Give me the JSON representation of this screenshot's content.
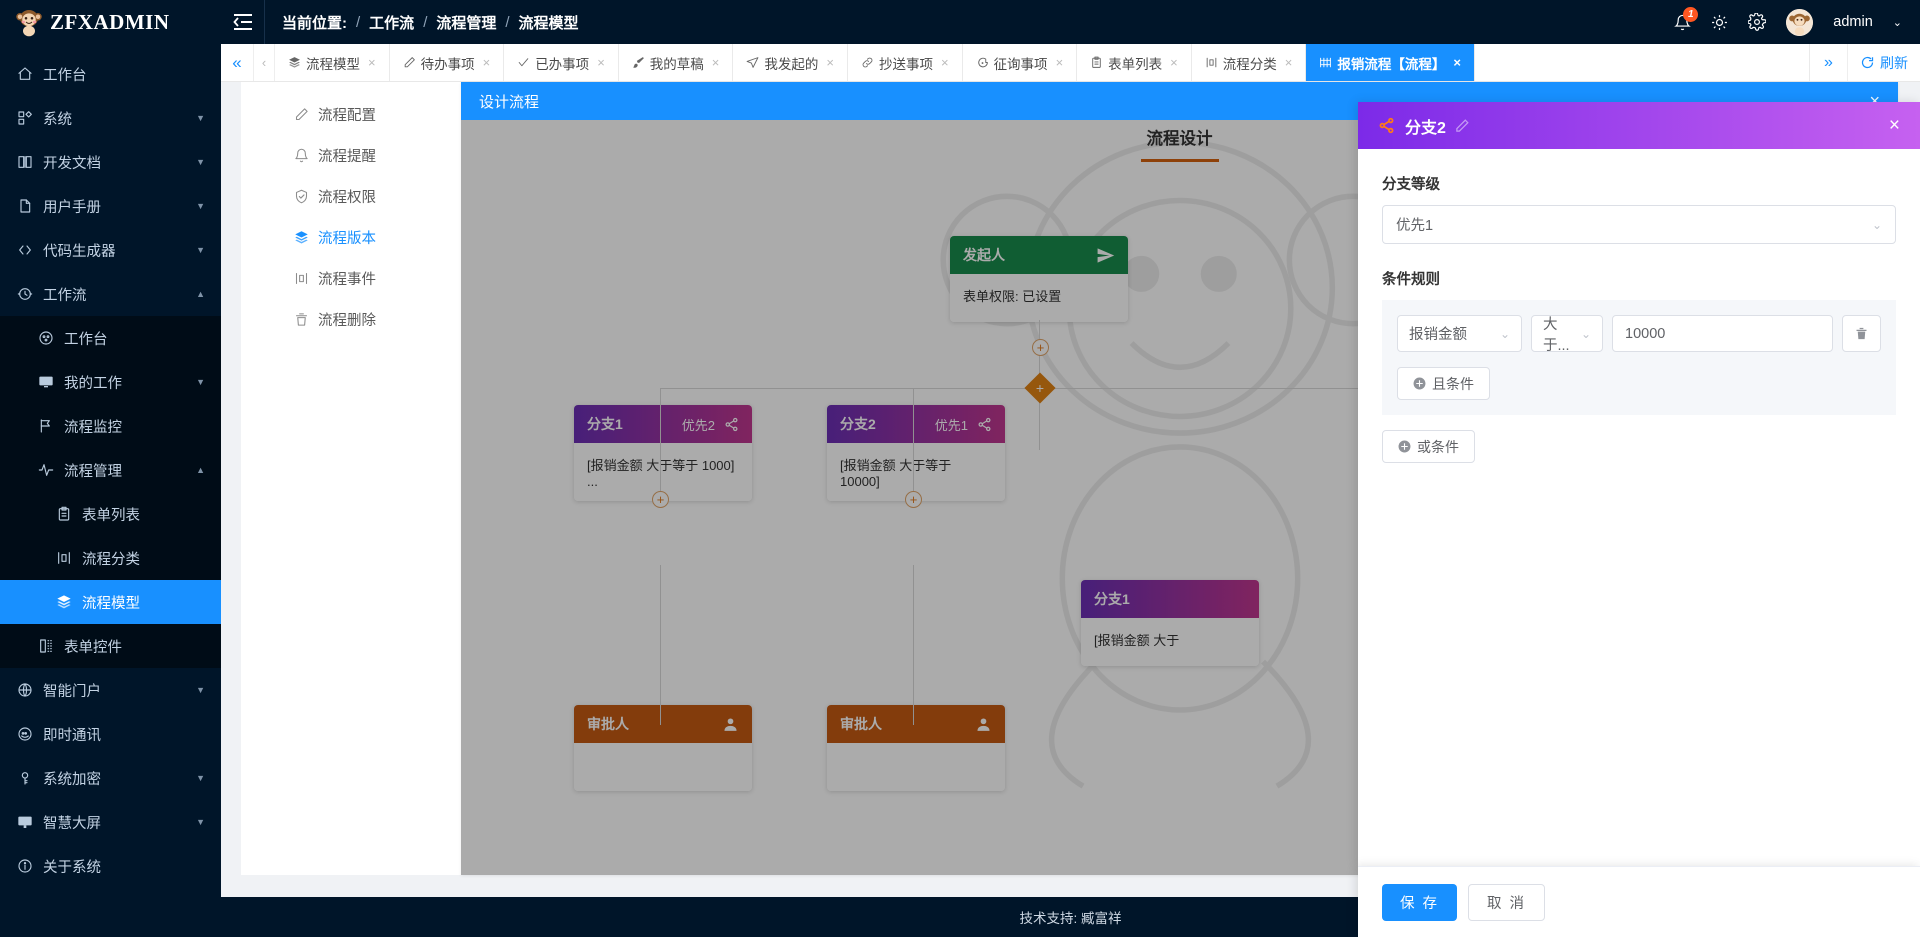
{
  "brand": {
    "name": "ZFXADMIN"
  },
  "header": {
    "breadcrumb_label": "当前位置:",
    "breadcrumb": [
      "工作流",
      "流程管理",
      "流程模型"
    ],
    "separator": "/",
    "notification_count": "1",
    "username": "admin"
  },
  "sidebar": {
    "items": [
      {
        "label": "工作台",
        "icon": "home-icon",
        "level": 0,
        "caret": false,
        "active": false
      },
      {
        "label": "系统",
        "icon": "apps-icon",
        "level": 0,
        "caret": true,
        "active": false
      },
      {
        "label": "开发文档",
        "icon": "book-icon",
        "level": 0,
        "caret": true,
        "active": false
      },
      {
        "label": "用户手册",
        "icon": "doc-icon",
        "level": 0,
        "caret": true,
        "active": false
      },
      {
        "label": "代码生成器",
        "icon": "code-icon",
        "level": 0,
        "caret": true,
        "active": false
      },
      {
        "label": "工作流",
        "icon": "workflow-icon",
        "level": 0,
        "caret": true,
        "active": false,
        "expanded": true
      },
      {
        "label": "工作台",
        "icon": "dashboard-icon",
        "level": 1,
        "caret": false,
        "active": false
      },
      {
        "label": "我的工作",
        "icon": "monitor-icon",
        "level": 1,
        "caret": true,
        "active": false
      },
      {
        "label": "流程监控",
        "icon": "flag-icon",
        "level": 1,
        "caret": false,
        "active": false
      },
      {
        "label": "流程管理",
        "icon": "pulse-icon",
        "level": 1,
        "caret": true,
        "active": false,
        "expanded": true
      },
      {
        "label": "表单列表",
        "icon": "clipboard-icon",
        "level": 2,
        "caret": false,
        "active": false
      },
      {
        "label": "流程分类",
        "icon": "category-icon",
        "level": 2,
        "caret": false,
        "active": false
      },
      {
        "label": "流程模型",
        "icon": "layers-icon",
        "level": 2,
        "caret": false,
        "active": true
      },
      {
        "label": "表单控件",
        "icon": "widget-icon",
        "level": 1,
        "caret": false,
        "active": false
      },
      {
        "label": "智能门户",
        "icon": "globe-icon",
        "level": 0,
        "caret": true,
        "active": false
      },
      {
        "label": "即时通讯",
        "icon": "chat-icon",
        "level": 0,
        "caret": false,
        "active": false
      },
      {
        "label": "系统加密",
        "icon": "key-icon",
        "level": 0,
        "caret": true,
        "active": false
      },
      {
        "label": "智慧大屏",
        "icon": "screen-icon",
        "level": 0,
        "caret": true,
        "active": false
      },
      {
        "label": "关于系统",
        "icon": "info-icon",
        "level": 0,
        "caret": false,
        "active": false
      }
    ]
  },
  "tabs": {
    "items": [
      {
        "label": "流程模型",
        "icon": "layers-icon",
        "active": false
      },
      {
        "label": "待办事项",
        "icon": "pen-icon",
        "active": false
      },
      {
        "label": "已办事项",
        "icon": "check-icon",
        "active": false
      },
      {
        "label": "我的草稿",
        "icon": "brush-icon",
        "active": false
      },
      {
        "label": "我发起的",
        "icon": "send-icon",
        "active": false
      },
      {
        "label": "抄送事项",
        "icon": "link-icon",
        "active": false
      },
      {
        "label": "征询事项",
        "icon": "comment-icon",
        "active": false
      },
      {
        "label": "表单列表",
        "icon": "clipboard-icon",
        "active": false
      },
      {
        "label": "流程分类",
        "icon": "category-icon",
        "active": false
      },
      {
        "label": "报销流程【流程】",
        "icon": "flow-icon",
        "active": true
      }
    ],
    "close_glyph": "×",
    "refresh_label": "刷新"
  },
  "side_menu": {
    "items": [
      {
        "label": "流程配置",
        "icon": "pen-icon",
        "active": false
      },
      {
        "label": "流程提醒",
        "icon": "bell-icon",
        "active": false
      },
      {
        "label": "流程权限",
        "icon": "shield-icon",
        "active": false
      },
      {
        "label": "流程版本",
        "icon": "layers-icon",
        "active": true
      },
      {
        "label": "流程事件",
        "icon": "category-icon",
        "active": false
      },
      {
        "label": "流程删除",
        "icon": "trash-icon",
        "active": false
      }
    ]
  },
  "designer": {
    "title": "设计流程",
    "tab_label": "流程设计",
    "nodes": {
      "start": {
        "title": "发起人",
        "body": "表单权限: 已设置",
        "icon": "send-icon"
      },
      "branch1": {
        "title": "分支1",
        "priority": "优先2",
        "body": "[报销金额 大于等于 1000] ...",
        "icon": "share-icon"
      },
      "branch2": {
        "title": "分支2",
        "priority": "优先1",
        "body": "[报销金额 大于等于 10000]",
        "icon": "share-icon"
      },
      "branch3": {
        "title": "分支1",
        "priority": "",
        "body": "[报销金额 大于",
        "icon": "share-icon"
      },
      "approver1": {
        "title": "审批人",
        "body": "",
        "icon": "user-icon"
      },
      "approver2": {
        "title": "审批人",
        "body": "",
        "icon": "user-icon"
      }
    },
    "plus_glyph": "+"
  },
  "panel": {
    "title": "分支2",
    "close_glyph": "×",
    "level_label": "分支等级",
    "level_value": "优先1",
    "rules_label": "条件规则",
    "rule": {
      "field": "报销金额",
      "operator": "大于...",
      "value": "10000"
    },
    "and_button": "且条件",
    "or_button": "或条件",
    "save_button": "保 存",
    "cancel_button": "取 消"
  },
  "footer": {
    "text": "技术支持: 臧富祥"
  },
  "colors": {
    "primary": "#1890ff",
    "sidebar_bg": "#001529",
    "branch_start": "#6b2fb5",
    "branch_end": "#c0368e",
    "start_node": "#188b4c",
    "approver_node": "#c35a13",
    "accent_orange": "#e08214",
    "panel_head_start": "#7c2ae8",
    "panel_head_end": "#c661f0"
  }
}
